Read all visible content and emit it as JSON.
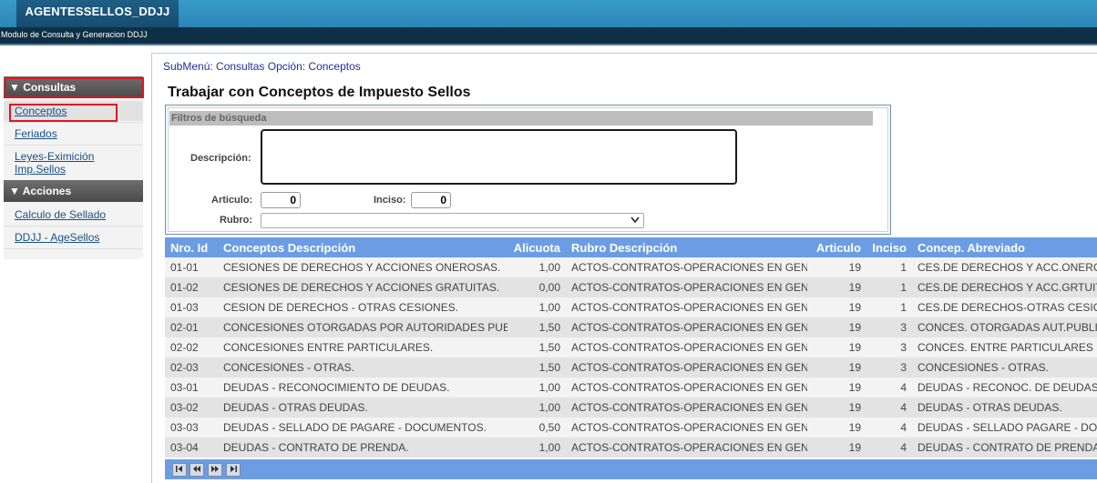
{
  "app": {
    "title": "AGENTESSELLOS_DDJJ",
    "subtitle": "Modulo de Consulta y Generacion DDJJ"
  },
  "sidebar": {
    "consultas_label": "▼ Consultas",
    "consultas_items": [
      {
        "label": "Conceptos"
      },
      {
        "label": "Feriados"
      },
      {
        "label": "Leyes-Eximición Imp.Sellos"
      }
    ],
    "acciones_label": "▼ Acciones",
    "acciones_items": [
      {
        "label": "Calculo de Sellado"
      },
      {
        "label": "DDJJ - AgeSellos"
      }
    ]
  },
  "main": {
    "submenu": "SubMenú: Consultas Opción: Conceptos",
    "title": "Trabajar con Conceptos de Impuesto Sellos"
  },
  "filters": {
    "header": "Filtros de búsqueda",
    "descripcion_label": "Descripción:",
    "descripcion_value": "",
    "articulo_label": "Articulo:",
    "articulo_value": "0",
    "inciso_label": "Inciso:",
    "inciso_value": "0",
    "rubro_label": "Rubro:",
    "rubro_value": ""
  },
  "table": {
    "headers": {
      "id": "Nro. Id",
      "desc": "Conceptos Descripción",
      "alicuota": "Alicuota",
      "rubro": "Rubro Descripción",
      "articulo": "Articulo",
      "inciso": "Inciso",
      "abreviado": "Concep. Abreviado"
    },
    "rows": [
      [
        "01-01",
        "CESIONES DE DERECHOS Y ACCIONES ONEROSAS.",
        "1,00",
        "ACTOS-CONTRATOS-OPERACIONES EN GENERAL",
        "19",
        "1",
        "CES.DE DERECHOS Y ACC.ONEROSAS"
      ],
      [
        "01-02",
        "CESIONES DE DERECHOS Y ACCIONES GRATUITAS.",
        "0,00",
        "ACTOS-CONTRATOS-OPERACIONES EN GENERAL",
        "19",
        "1",
        "CES.DE DERECHOS Y ACC.GRTUITAS"
      ],
      [
        "01-03",
        "CESION DE DERECHOS - OTRAS CESIONES.",
        "1,00",
        "ACTOS-CONTRATOS-OPERACIONES EN GENERAL",
        "19",
        "1",
        "CES.DE DERECHOS-OTRAS CESIONES"
      ],
      [
        "02-01",
        "CONCESIONES OTORGADAS POR AUTORIDADES PUBLICAS.",
        "1,50",
        "ACTOS-CONTRATOS-OPERACIONES EN GENERAL",
        "19",
        "3",
        "CONCES. OTORGADAS AUT.PUBLICAS"
      ],
      [
        "02-02",
        "CONCESIONES ENTRE PARTICULARES.",
        "1,50",
        "ACTOS-CONTRATOS-OPERACIONES EN GENERAL",
        "19",
        "3",
        "CONCES. ENTRE PARTICULARES"
      ],
      [
        "02-03",
        "CONCESIONES - OTRAS.",
        "1,50",
        "ACTOS-CONTRATOS-OPERACIONES EN GENERAL",
        "19",
        "3",
        "CONCESIONES - OTRAS."
      ],
      [
        "03-01",
        "DEUDAS - RECONOCIMIENTO DE DEUDAS.",
        "1,00",
        "ACTOS-CONTRATOS-OPERACIONES EN GENERAL",
        "19",
        "4",
        "DEUDAS - RECONOC. DE DEUDAS"
      ],
      [
        "03-02",
        "DEUDAS - OTRAS DEUDAS.",
        "1,00",
        "ACTOS-CONTRATOS-OPERACIONES EN GENERAL",
        "19",
        "4",
        "DEUDAS - OTRAS DEUDAS."
      ],
      [
        "03-03",
        "DEUDAS - SELLADO DE PAGARE - DOCUMENTOS.",
        "0,50",
        "ACTOS-CONTRATOS-OPERACIONES EN GENERAL",
        "19",
        "4",
        "DEUDAS - SELLADO PAGARE - DOC."
      ],
      [
        "03-04",
        "DEUDAS - CONTRATO DE PRENDA.",
        "1,00",
        "ACTOS-CONTRATOS-OPERACIONES EN GENERAL",
        "19",
        "4",
        "DEUDAS - CONTRATO DE PRENDA"
      ]
    ]
  },
  "pager": {
    "icons": [
      "first-page-icon",
      "prev-page-icon",
      "next-page-icon",
      "last-page-icon"
    ]
  },
  "colors": {
    "header_blue": "#6c9de3",
    "highlight_red": "#e0151f",
    "link_blue": "#1a4f86"
  }
}
